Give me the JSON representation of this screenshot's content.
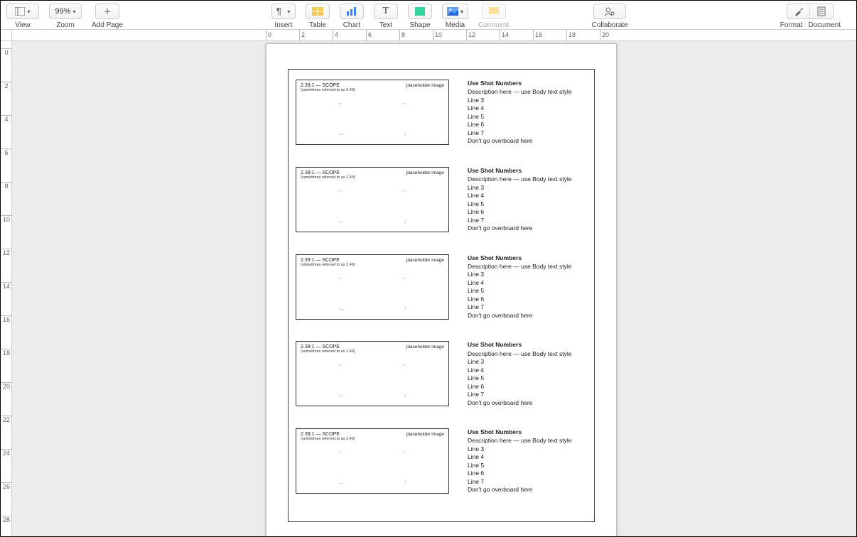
{
  "toolbar": {
    "view_label": "View",
    "zoom_value": "99%",
    "zoom_label": "Zoom",
    "add_page": "Add Page",
    "insert": "Insert",
    "table": "Table",
    "chart": "Chart",
    "text": "Text",
    "shape": "Shape",
    "media": "Media",
    "comment": "Comment",
    "collaborate": "Collaborate",
    "format": "Format",
    "document": "Document"
  },
  "ruler_h": [
    "0",
    "2",
    "4",
    "6",
    "8",
    "10",
    "12",
    "14",
    "16",
    "18",
    "20"
  ],
  "ruler_v": [
    "0",
    "2",
    "4",
    "6",
    "8",
    "10",
    "12",
    "14",
    "16",
    "18",
    "20",
    "22",
    "24",
    "26",
    "28"
  ],
  "placeholder": {
    "ratio": "2.39:1 — SCOPE",
    "sub": "(sometimes referred to as 2.40)",
    "ph_label": "placeholder image"
  },
  "shot_lines": {
    "title": "Use Shot Numbers",
    "desc": "Description here — use Body text style",
    "l3": "Line 3",
    "l4": "Line 4",
    "l5": "Line 5",
    "l6": "Line 6",
    "l7": "Line 7",
    "over": "Don't go overboard here"
  },
  "row_count": 5
}
